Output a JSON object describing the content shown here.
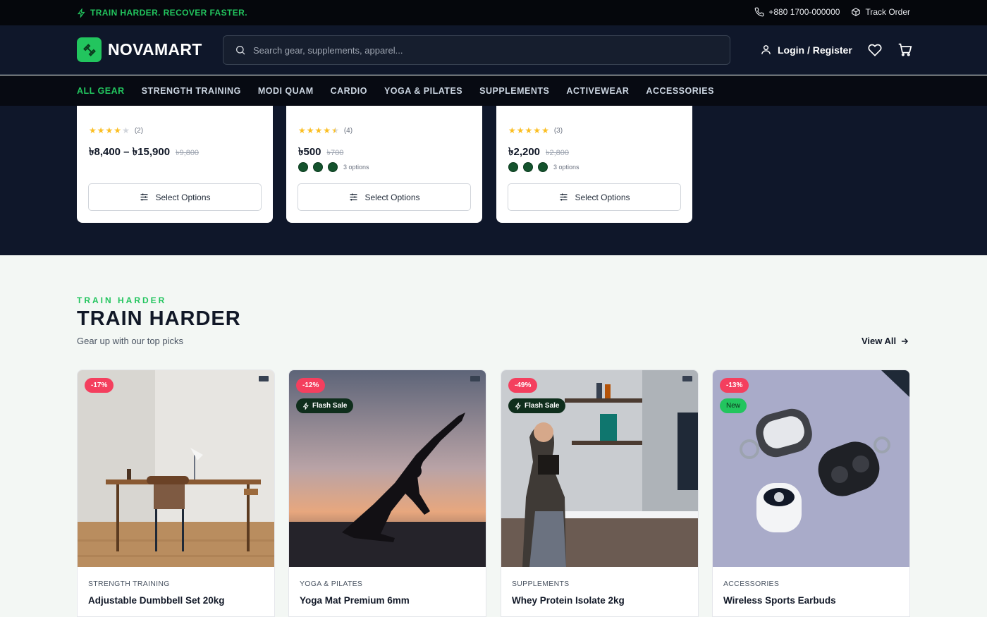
{
  "topbar": {
    "promo": "TRAIN HARDER. RECOVER FASTER.",
    "phone": "+880 1700-000000",
    "track_order": "Track Order"
  },
  "header": {
    "logo_text": "NOVAMART",
    "search_placeholder": "Search gear, supplements, apparel...",
    "login_label": "Login / Register"
  },
  "nav": {
    "items": [
      "ALL GEAR",
      "STRENGTH TRAINING",
      "MODI QUAM",
      "CARDIO",
      "YOGA & PILATES",
      "SUPPLEMENTS",
      "ACTIVEWEAR",
      "ACCESSORIES"
    ],
    "active_index": 0
  },
  "top_cards": [
    {
      "rating": 4,
      "review_count": "(2)",
      "price": "৳8,400 – ৳15,900",
      "old_price": "৳9,800",
      "swatches": 0,
      "options_label": "",
      "button": "Select Options"
    },
    {
      "rating": 4.5,
      "review_count": "(4)",
      "price": "৳500",
      "old_price": "৳700",
      "swatches": 3,
      "options_label": "3 options",
      "button": "Select Options"
    },
    {
      "rating": 5,
      "review_count": "(3)",
      "price": "৳2,200",
      "old_price": "৳2,800",
      "swatches": 3,
      "options_label": "3 options",
      "button": "Select Options"
    }
  ],
  "section": {
    "eyebrow": "TRAIN HARDER",
    "title": "TRAIN HARDER",
    "subtitle": "Gear up with our top picks",
    "view_all": "View All"
  },
  "products": [
    {
      "discount": "-17%",
      "flash": "",
      "new": "",
      "category": "STRENGTH TRAINING",
      "name": "Adjustable Dumbbell Set 20kg",
      "image": "desk-chair-room"
    },
    {
      "discount": "-12%",
      "flash": "Flash Sale",
      "new": "",
      "category": "YOGA & PILATES",
      "name": "Yoga Mat Premium 6mm",
      "image": "yoga-silhouette-sunset"
    },
    {
      "discount": "-49%",
      "flash": "Flash Sale",
      "new": "",
      "category": "SUPPLEMENTS",
      "name": "Whey Protein Isolate 2kg",
      "image": "woman-kitchen-shake"
    },
    {
      "discount": "-13%",
      "flash": "",
      "new": "New",
      "category": "ACCESSORIES",
      "name": "Wireless Sports Earbuds",
      "image": "earbuds-cases"
    }
  ],
  "colors": {
    "accent": "#22c55e",
    "dark_bg": "#0f172a",
    "discount_badge": "#f43f5e",
    "star": "#fbbf24"
  }
}
